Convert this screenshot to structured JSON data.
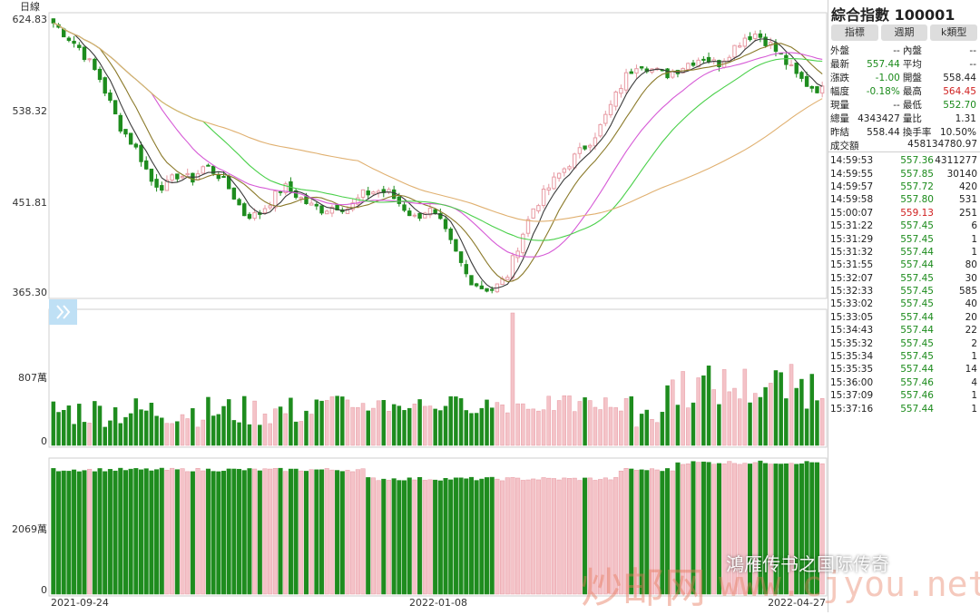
{
  "chart": {
    "period_label": "日線",
    "price_axis": [
      "624.83",
      "538.32",
      "451.81",
      "365.30"
    ],
    "volume_axis": [
      "807萬",
      "0"
    ],
    "amount_axis": [
      "2069萬",
      "0"
    ],
    "dates": [
      "2021-09-24",
      "2022-01-08",
      "2022-04-27"
    ],
    "colors": {
      "up": "#f4c3c8",
      "up_border": "#e79aa3",
      "down": "#1e8c1e",
      "ma5": "#3a3a3a",
      "ma10": "#8b7a2a",
      "ma20": "#d65bd6",
      "ma30": "#4ad04a",
      "ma60": "#e0b070"
    }
  },
  "panel": {
    "title": "綜合指數 100001",
    "buttons": [
      "指標",
      "週期",
      "k類型"
    ],
    "quote": [
      [
        {
          "l": "外盤",
          "v": "--",
          "c": "k"
        },
        {
          "l": "內盤",
          "v": "--",
          "c": "k"
        }
      ],
      [
        {
          "l": "最新",
          "v": "557.44",
          "c": "g"
        },
        {
          "l": "平均",
          "v": "--",
          "c": "k"
        }
      ],
      [
        {
          "l": "漲跌",
          "v": "-1.00",
          "c": "g"
        },
        {
          "l": "開盤",
          "v": "558.44",
          "c": "k"
        }
      ],
      [
        {
          "l": "幅度",
          "v": "-0.18%",
          "c": "g"
        },
        {
          "l": "最高",
          "v": "564.45",
          "c": "r"
        }
      ],
      [
        {
          "l": "現量",
          "v": "--",
          "c": "k"
        },
        {
          "l": "最低",
          "v": "552.70",
          "c": "g"
        }
      ],
      [
        {
          "l": "總量",
          "v": "4343427",
          "c": "k"
        },
        {
          "l": "量比",
          "v": "1.31",
          "c": "k"
        }
      ],
      [
        {
          "l": "昨結",
          "v": "558.44",
          "c": "k"
        },
        {
          "l": "換手率",
          "v": "10.50%",
          "c": "k"
        }
      ]
    ],
    "amount_label": "成交額",
    "amount_value": "458134780.97",
    "ticks": [
      {
        "t": "14:59:53",
        "p": "557.36",
        "c": "g",
        "v": "4311277"
      },
      {
        "t": "14:59:55",
        "p": "557.85",
        "c": "g",
        "v": "30140"
      },
      {
        "t": "14:59:57",
        "p": "557.72",
        "c": "g",
        "v": "420"
      },
      {
        "t": "14:59:58",
        "p": "557.80",
        "c": "g",
        "v": "531"
      },
      {
        "t": "15:00:07",
        "p": "559.13",
        "c": "r",
        "v": "251"
      },
      {
        "t": "15:31:22",
        "p": "557.45",
        "c": "g",
        "v": "6"
      },
      {
        "t": "15:31:29",
        "p": "557.45",
        "c": "g",
        "v": "1"
      },
      {
        "t": "15:31:32",
        "p": "557.44",
        "c": "g",
        "v": "1"
      },
      {
        "t": "15:31:55",
        "p": "557.44",
        "c": "g",
        "v": "80"
      },
      {
        "t": "15:32:07",
        "p": "557.45",
        "c": "g",
        "v": "30"
      },
      {
        "t": "15:32:33",
        "p": "557.45",
        "c": "g",
        "v": "585"
      },
      {
        "t": "15:33:02",
        "p": "557.45",
        "c": "g",
        "v": "40"
      },
      {
        "t": "15:33:05",
        "p": "557.44",
        "c": "g",
        "v": "20"
      },
      {
        "t": "15:34:43",
        "p": "557.44",
        "c": "g",
        "v": "22"
      },
      {
        "t": "15:35:32",
        "p": "557.45",
        "c": "g",
        "v": "2"
      },
      {
        "t": "15:35:34",
        "p": "557.45",
        "c": "g",
        "v": "1"
      },
      {
        "t": "15:35:35",
        "p": "557.44",
        "c": "g",
        "v": "14"
      },
      {
        "t": "15:36:00",
        "p": "557.46",
        "c": "g",
        "v": "4"
      },
      {
        "t": "15:37:09",
        "p": "557.46",
        "c": "g",
        "v": "1"
      },
      {
        "t": "15:37:16",
        "p": "557.44",
        "c": "g",
        "v": "1"
      }
    ]
  },
  "watermark": {
    "site_cn": "炒邮网",
    "site_url": "www.cjyou.net",
    "account": "鴻雁传书之国际传奇"
  }
}
